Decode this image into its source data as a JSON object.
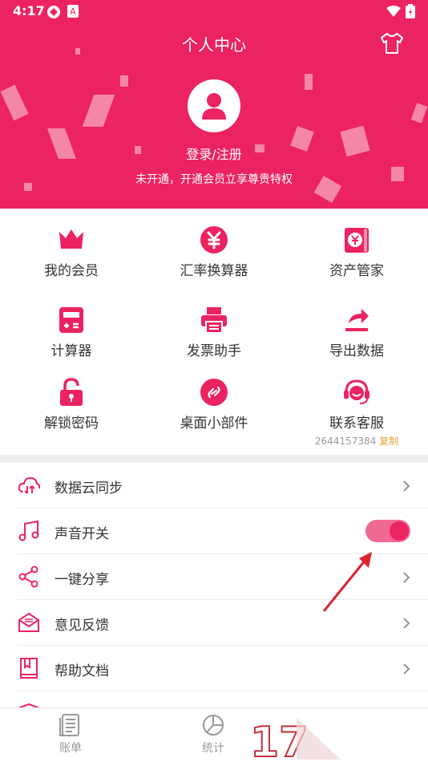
{
  "status_bar": {
    "time": "4:17"
  },
  "header": {
    "title": "个人中心",
    "login_label": "登录/注册",
    "vip_tip": "未开通，开通会员立享尊贵特权",
    "theme_color": "#ec2361"
  },
  "grid": {
    "items": [
      {
        "label": "我的会员",
        "icon": "crown-icon"
      },
      {
        "label": "汇率换算器",
        "icon": "yen-icon"
      },
      {
        "label": "资产管家",
        "icon": "wallet-icon"
      },
      {
        "label": "计算器",
        "icon": "calculator-icon"
      },
      {
        "label": "发票助手",
        "icon": "printer-icon"
      },
      {
        "label": "导出数据",
        "icon": "export-icon"
      },
      {
        "label": "解锁密码",
        "icon": "lock-icon"
      },
      {
        "label": "桌面小部件",
        "icon": "widget-icon"
      },
      {
        "label": "联系客服",
        "icon": "headset-icon",
        "sub": "2644157384",
        "sub_action": "复制"
      }
    ]
  },
  "settings": {
    "items": [
      {
        "label": "数据云同步",
        "icon": "cloud-sync-icon"
      },
      {
        "label": "声音开关",
        "icon": "music-icon",
        "toggle_on": true
      },
      {
        "label": "一键分享",
        "icon": "share-icon"
      },
      {
        "label": "意见反馈",
        "icon": "mail-icon"
      },
      {
        "label": "帮助文档",
        "icon": "book-icon"
      }
    ]
  },
  "bottom_nav": {
    "items": [
      {
        "label": "账单",
        "icon": "bill-icon"
      },
      {
        "label": "统计",
        "icon": "pie-chart-icon"
      }
    ]
  }
}
